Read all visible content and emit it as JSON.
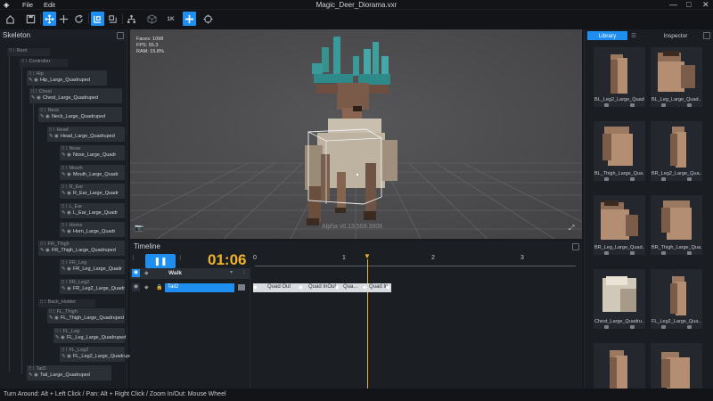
{
  "menubar": {
    "items": [
      "File",
      "Edit"
    ],
    "title": "Magic_Deer_Diorama.vxr",
    "controls": [
      "—",
      "□",
      "✕"
    ]
  },
  "toolbar": {
    "buttons": [
      "app-logo-icon",
      "save-icon",
      "select-move-icon",
      "move-icon",
      "rotate-icon",
      "link-mode-icon",
      "link-add-icon",
      "hierarchy-icon",
      "cube-icon",
      "1K",
      "add-joint-icon",
      "target-icon"
    ],
    "one_k": "1K"
  },
  "skeleton": {
    "title": "Skeleton",
    "nodes": [
      {
        "name": "Root",
        "mesh": ""
      },
      {
        "name": "Controller",
        "mesh": ""
      },
      {
        "name": "Hip",
        "mesh": "Hip_Large_Quadruped"
      },
      {
        "name": "Chest",
        "mesh": "Chest_Large_Quadruped"
      },
      {
        "name": "Neck",
        "mesh": "Neck_Large_Quadruped"
      },
      {
        "name": "Head",
        "mesh": "Head_Large_Quadruped"
      },
      {
        "name": "Nose",
        "mesh": "Nose_Large_Quadr"
      },
      {
        "name": "Mouth",
        "mesh": "Mouth_Large_Quadr"
      },
      {
        "name": "R_Ear",
        "mesh": "R_Ear_Large_Quadr"
      },
      {
        "name": "L_Ear",
        "mesh": "L_Ear_Large_Quadr"
      },
      {
        "name": "Horns",
        "mesh": "Horn_Large_Quadr"
      },
      {
        "name": "FR_Thigh",
        "mesh": "FR_Thigh_Large_Quadruped"
      },
      {
        "name": "FR_Leg",
        "mesh": "FR_Leg_Large_Quadr"
      },
      {
        "name": "FR_Leg2",
        "mesh": "FR_Leg2_Large_Quadr"
      },
      {
        "name": "Back_Holder",
        "mesh": ""
      },
      {
        "name": "FL_Thigh",
        "mesh": "FL_Thigh_Large_Quadruped"
      },
      {
        "name": "FL_Leg",
        "mesh": "FL_Leg_Large_Quadruped"
      },
      {
        "name": "FL_Leg2",
        "mesh": "FL_Leg2_Large_Quadruped"
      },
      {
        "name": "Tail1",
        "mesh": "Tail_Large_Quadruped"
      }
    ]
  },
  "viewport": {
    "stats": [
      "Faces: 1098",
      "FPS: 55.3",
      "RAM: 15.8%"
    ],
    "watermark": "Alpha v0.13.559.3906"
  },
  "timeline": {
    "title": "Timeline",
    "time": "01:06",
    "ruler": [
      "0",
      "1",
      "2",
      "3"
    ],
    "tracks": [
      {
        "name": "Walk"
      },
      {
        "name": "Tail2",
        "keys": [
          "Quad Out",
          "Quad InOut",
          "Qua...",
          "Quad In"
        ]
      }
    ]
  },
  "library": {
    "tabs": [
      "Library",
      "Inspector"
    ],
    "items": [
      "BL_Leg2_Large_Quad...",
      "BL_Leg_Large_Quad...",
      "BL_Thigh_Large_Qua...",
      "BR_Leg2_Large_Qua...",
      "BR_Leg_Large_Quad...",
      "BR_Thigh_Large_Qua...",
      "Chest_Large_Quadru...",
      "FL_Leg2_Large_Qua...",
      "",
      ""
    ]
  },
  "status": "Turn Around: Alt + Left Click / Pan: Alt + Right Click / Zoom In/Out: Mouse Wheel",
  "colors": {
    "accent": "#1e8ff0",
    "time": "#f0b429",
    "playhead": "#f0b429"
  }
}
